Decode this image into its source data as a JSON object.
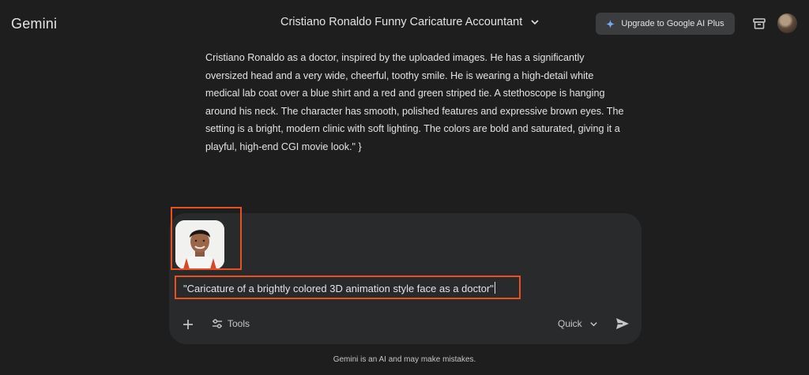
{
  "header": {
    "app_name": "Gemini",
    "chat_title": "Cristiano Ronaldo Funny Caricature Accountant",
    "upgrade_label": "Upgrade to Google AI Plus"
  },
  "response": {
    "lines": [
      "Cristiano Ronaldo as a doctor, inspired by the uploaded images. He has a significantly",
      "oversized head and a very wide, cheerful, toothy smile. He is wearing a high-detail white",
      "medical lab coat over a blue shirt and a red and green striped tie. A stethoscope is hanging",
      "around his neck. The character has smooth, polished features and expressive brown eyes. The",
      "setting is a bright, modern clinic with soft lighting. The colors are bold and saturated, giving it a",
      "playful, high-end CGI movie look.\" }"
    ]
  },
  "composer": {
    "prompt_value": "\"Caricature of a brightly colored 3D animation style face as a doctor\"",
    "tools_label": "Tools",
    "mode_label": "Quick"
  },
  "footer": {
    "disclaimer": "Gemini is an AI and may make mistakes."
  },
  "colors": {
    "background": "#1e1e1f",
    "composer": "#282a2c",
    "highlight": "#e8511f"
  },
  "icons": [
    "chevron-down-icon",
    "sparkle-icon",
    "archive-icon",
    "plus-icon",
    "tools-icon",
    "send-icon"
  ]
}
